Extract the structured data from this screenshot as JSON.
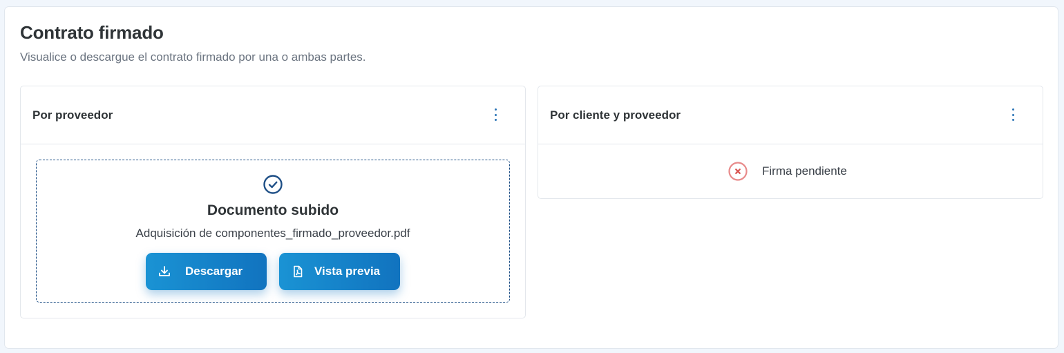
{
  "page": {
    "title": "Contrato firmado",
    "subtitle": "Visualice o descargue el contrato firmado por una o ambas partes."
  },
  "provider_card": {
    "title": "Por proveedor",
    "menu_icon": "kebab-menu-icon",
    "document": {
      "status_icon": "check-circle-icon",
      "status_title": "Documento subido",
      "file_name": "Adquisición de componentes_firmado_proveedor.pdf",
      "download_label": "Descargar",
      "download_icon": "download-icon",
      "preview_label": "Vista previa",
      "preview_icon": "pdf-file-icon"
    }
  },
  "both_card": {
    "title": "Por cliente y proveedor",
    "menu_icon": "kebab-menu-icon",
    "status_icon": "x-circle-icon",
    "status_text": "Firma pendiente"
  },
  "colors": {
    "accent_start": "#1a93d4",
    "accent_end": "#1173bf",
    "success_icon": "#1e4f86",
    "pending_icon": "#e88a8a",
    "kebab": "#2b74b6"
  }
}
